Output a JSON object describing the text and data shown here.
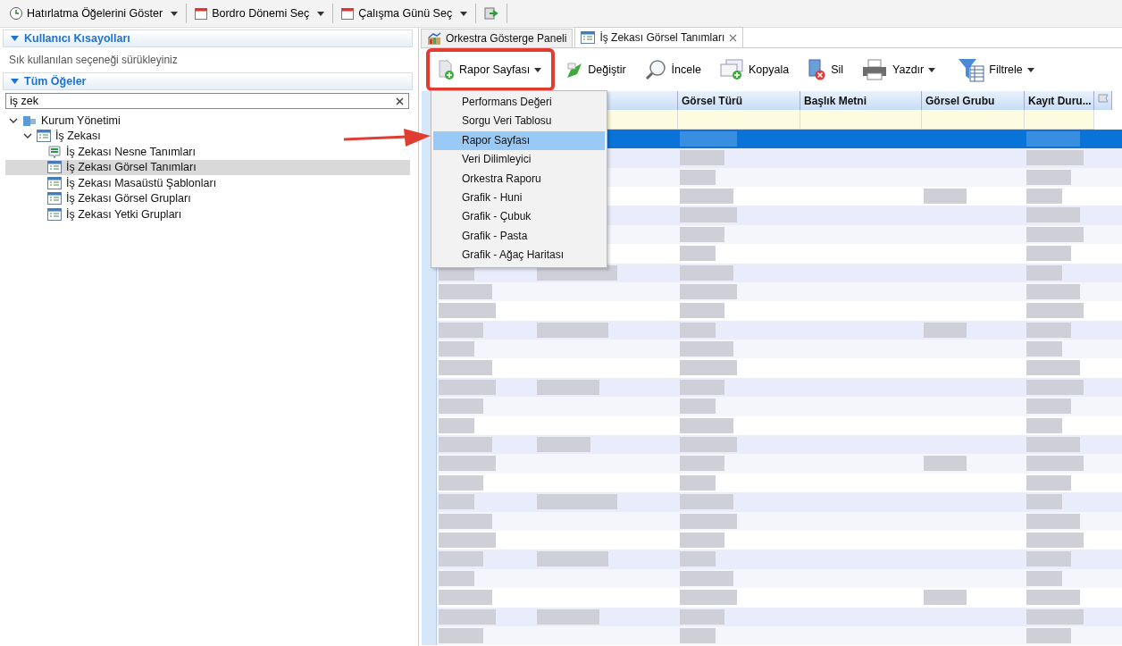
{
  "top_toolbar": [
    {
      "label": "Hatırlatma Öğelerini Göster",
      "kind": "clock",
      "dropdown": true
    },
    {
      "label": "Bordro Dönemi Seç",
      "kind": "calendar",
      "dropdown": true
    },
    {
      "label": "Çalışma Günü Seç",
      "kind": "calendar",
      "dropdown": true
    },
    {
      "kind": "export",
      "dropdown": false
    }
  ],
  "sidebar": {
    "sections": [
      {
        "title": "Kullanıcı Kısayolları",
        "expanded": true,
        "hint": "Sık kullanılan seçeneği sürükleyiniz"
      },
      {
        "title": "Tüm Öğeler",
        "expanded": true
      }
    ],
    "search": {
      "value": "iş zek"
    },
    "tree": [
      {
        "label": "Kurum Yönetimi",
        "kind": "building",
        "expanded": true,
        "selected": false,
        "children": [
          {
            "label": "İş Zekası",
            "kind": "list",
            "expanded": true,
            "selected": false,
            "children": [
              {
                "label": "İş Zekası Nesne Tanımları",
                "kind": "object",
                "selected": false
              },
              {
                "label": "İş Zekası Görsel Tanımları",
                "kind": "list",
                "selected": true
              },
              {
                "label": "İş Zekası Masaüstü Şablonları",
                "kind": "list",
                "selected": false
              },
              {
                "label": "İş Zekası Görsel Grupları",
                "kind": "list",
                "selected": false
              },
              {
                "label": "İş Zekası Yetki Grupları",
                "kind": "list",
                "selected": false
              }
            ]
          }
        ]
      }
    ]
  },
  "tabs": [
    {
      "label": "Orkestra Gösterge Paneli",
      "kind": "dashboard",
      "selected": false,
      "closable": false
    },
    {
      "label": "İş Zekası Görsel Tanımları",
      "kind": "list",
      "selected": true,
      "closable": true
    }
  ],
  "toolbar": [
    {
      "label": "Rapor Sayfası",
      "kind": "newpage",
      "dropdown": true,
      "highlighted": true
    },
    {
      "label": "Değiştir",
      "kind": "edit",
      "dropdown": false,
      "highlighted": false
    },
    {
      "label": "İncele",
      "kind": "magnifier",
      "dropdown": false,
      "highlighted": false
    },
    {
      "label": "Kopyala",
      "kind": "copy",
      "dropdown": false,
      "highlighted": false
    },
    {
      "label": "Sil",
      "kind": "delete",
      "dropdown": false,
      "highlighted": false
    },
    {
      "label": "Yazdır",
      "kind": "printer",
      "dropdown": true,
      "highlighted": false
    },
    {
      "label": "Filtrele",
      "kind": "funnel",
      "dropdown": true,
      "highlighted": false
    }
  ],
  "dropdown_menu": [
    {
      "label": "Performans Değeri",
      "selected": false
    },
    {
      "label": "Sorgu Veri Tablosu",
      "selected": false
    },
    {
      "label": "Rapor Sayfası",
      "selected": true
    },
    {
      "label": "Veri Dilimleyici",
      "selected": false
    },
    {
      "label": "Orkestra Raporu",
      "selected": false
    },
    {
      "label": "Grafik - Huni",
      "selected": false
    },
    {
      "label": "Grafik - Çubuk",
      "selected": false
    },
    {
      "label": "Grafik - Pasta",
      "selected": false
    },
    {
      "label": "Grafik - Ağaç Haritası",
      "selected": false
    }
  ],
  "table": {
    "columns": [
      "",
      "Görsel Türü",
      "Başlık Metni",
      "Görsel Grubu",
      "Kayıt Duru..."
    ],
    "rows": [
      {
        "selected": true
      },
      {
        "selected": false
      },
      {
        "selected": false
      },
      {
        "selected": false
      },
      {
        "selected": false
      },
      {
        "selected": false
      },
      {
        "selected": false
      },
      {
        "selected": false
      },
      {
        "selected": false
      },
      {
        "selected": false
      },
      {
        "selected": false
      },
      {
        "selected": false
      },
      {
        "selected": false
      },
      {
        "selected": false
      },
      {
        "selected": false
      },
      {
        "selected": false
      },
      {
        "selected": false
      },
      {
        "selected": false
      },
      {
        "selected": false
      },
      {
        "selected": false
      },
      {
        "selected": false
      },
      {
        "selected": false
      },
      {
        "selected": false
      },
      {
        "selected": false
      },
      {
        "selected": false
      },
      {
        "selected": false
      },
      {
        "selected": false
      }
    ]
  },
  "annotation": {
    "arrow": true
  }
}
